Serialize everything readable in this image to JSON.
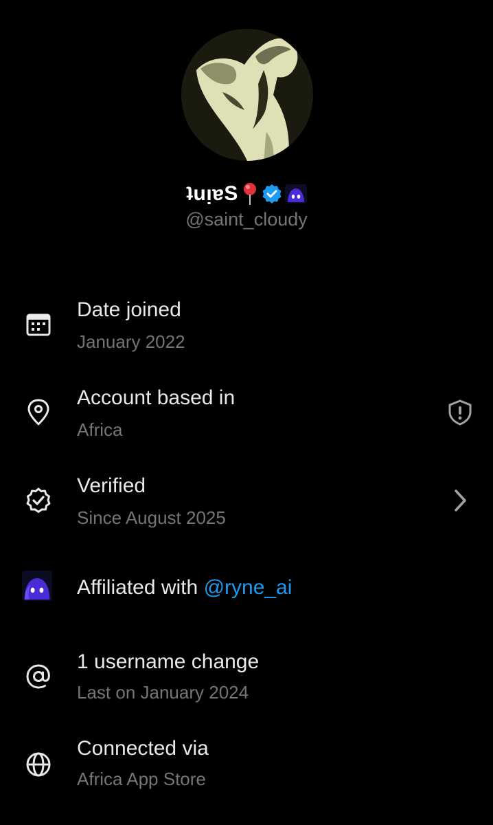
{
  "profile": {
    "display_name": "ʇuᴉɐS",
    "handle": "@saint_cloudy"
  },
  "items": [
    {
      "title": "Date joined",
      "subtitle": "January 2022",
      "icon": "calendar-icon"
    },
    {
      "title": "Account based in",
      "subtitle": "Africa",
      "icon": "location-pin-icon",
      "right_icon": "shield-alert-icon"
    },
    {
      "title": "Verified",
      "subtitle": "Since August 2025",
      "icon": "verified-check-icon",
      "right_icon": "chevron-right-icon"
    },
    {
      "title": "Affiliated with",
      "link": "@ryne_ai",
      "icon": "affiliate-avatar-icon"
    },
    {
      "title": "1 username change",
      "subtitle": "Last on January 2024",
      "icon": "at-sign-icon"
    },
    {
      "title": "Connected via",
      "subtitle": "Africa App Store",
      "icon": "globe-icon"
    }
  ],
  "colors": {
    "background": "#000000",
    "primary_text": "#e7e9ea",
    "secondary_text": "#71767b",
    "link": "#1d9bf0",
    "verified_badge": "#1d9bf0"
  }
}
